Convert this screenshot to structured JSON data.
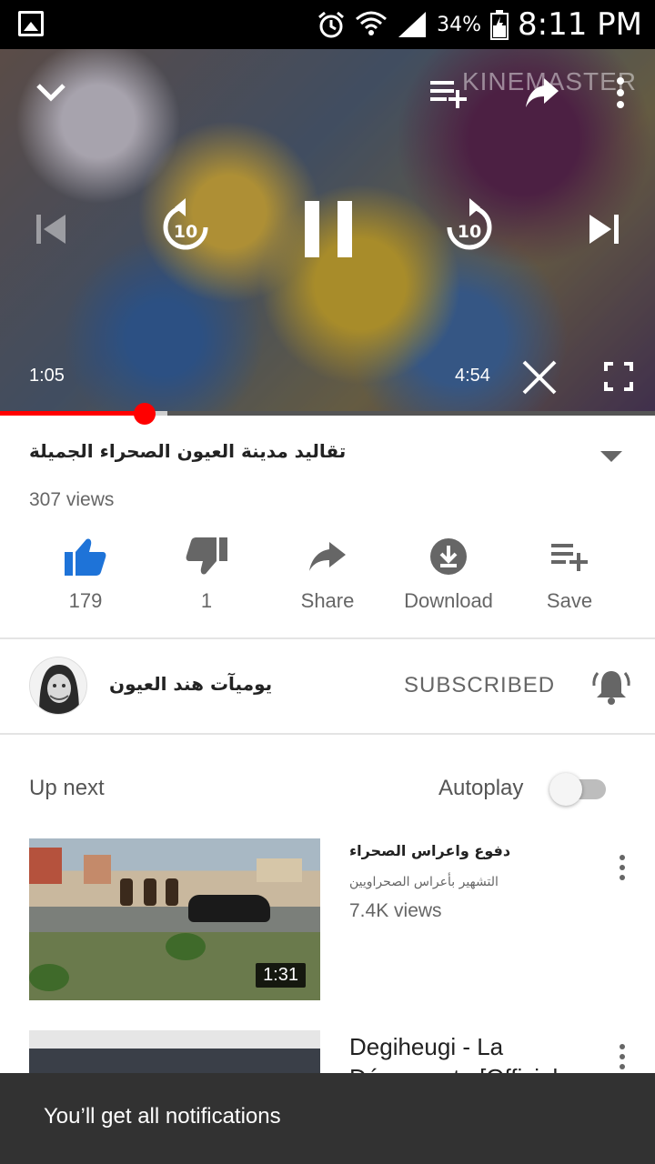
{
  "status_bar": {
    "battery_percent": "34%",
    "time": "8:11 PM",
    "icons": [
      "gallery-icon",
      "alarm-icon",
      "wifi-icon",
      "signal-icon",
      "battery-icon"
    ]
  },
  "player": {
    "watermark": "KINEMASTER",
    "elapsed": "1:05",
    "duration": "4:54",
    "progress_fraction": 0.221,
    "buffered_fraction": 0.256,
    "rewind_seconds": "10",
    "forward_seconds": "10"
  },
  "video": {
    "title": "تقاليد مدينة العيون الصحراء الجميلة",
    "views": "307 views"
  },
  "actions": {
    "like_count": "179",
    "dislike_count": "1",
    "share_label": "Share",
    "download_label": "Download",
    "save_label": "Save"
  },
  "channel": {
    "name": "يوميآت هند العيون",
    "subscribe_state": "SUBSCRIBED"
  },
  "up_next": {
    "heading": "Up next",
    "autoplay_label": "Autoplay",
    "autoplay_on": false,
    "items": [
      {
        "title": "دفوع واعراس الصحراء",
        "channel": "التشهير بأعراس الصحراويين",
        "views": "7.4K views",
        "duration": "1:31"
      },
      {
        "title": "Degiheugi - La Déroupante [Official"
      }
    ]
  },
  "snackbar": {
    "message": "You’ll get all notifications"
  },
  "colors": {
    "accent_red": "#ff0000",
    "like_active_blue": "#1e73d8",
    "snackbar_bg": "#323232"
  }
}
